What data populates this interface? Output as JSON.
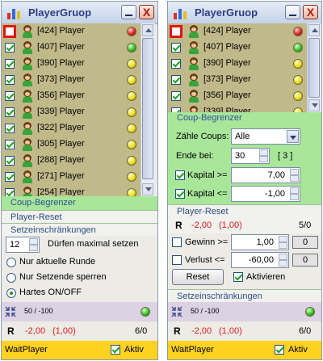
{
  "window_title": "PlayerGruop",
  "close_glyph": "X",
  "players": [
    {
      "label": "[424] Player",
      "checked": false,
      "status": "red"
    },
    {
      "label": "[407] Player",
      "checked": true,
      "status": "green"
    },
    {
      "label": "[390] Player",
      "checked": true,
      "status": "yellow"
    },
    {
      "label": "[373] Player",
      "checked": true,
      "status": "yellow"
    },
    {
      "label": "[356] Player",
      "checked": true,
      "status": "yellow"
    },
    {
      "label": "[339] Player",
      "checked": true,
      "status": "yellow"
    },
    {
      "label": "[322] Player",
      "checked": true,
      "status": "yellow"
    },
    {
      "label": "[305] Player",
      "checked": true,
      "status": "yellow"
    },
    {
      "label": "[288] Player",
      "checked": true,
      "status": "yellow"
    },
    {
      "label": "[271] Player",
      "checked": true,
      "status": "yellow"
    },
    {
      "label": "[254] Player",
      "checked": true,
      "status": "yellow"
    }
  ],
  "sections": {
    "coup_begrenzer": "Coup-Begrenzer",
    "player_reset": "Player-Reset",
    "setzeinschraenkungen": "Setzeinschränkungen"
  },
  "left": {
    "dueerfen_value": "12",
    "dueerfen_label": "Dürfen maximal setzen",
    "radios": [
      {
        "label": "Nur aktuelle Runde",
        "selected": false
      },
      {
        "label": "Nur Setzende sperren",
        "selected": false
      },
      {
        "label": "Hartes ON/OFF",
        "selected": true
      }
    ],
    "ratio": "50 / -100",
    "r_label": "R",
    "r_values": "-2,00",
    "r_paren": "(1,00)",
    "r_count": "6/0",
    "footer_name": "WaitPlayer",
    "aktiv_label": "Aktiv",
    "aktiv_checked": true
  },
  "right": {
    "zaehle_label": "Zähle Coups:",
    "zaehle_value": "Alle",
    "ende_label": "Ende bei:",
    "ende_value": "30",
    "ende_count": "[ 3 ]",
    "kapital_ge_label": "Kapital >=",
    "kapital_ge_value": "7,00",
    "kapital_ge_checked": true,
    "kapital_le_label": "Kapital <=",
    "kapital_le_value": "-1,00",
    "kapital_le_checked": true,
    "r_label": "R",
    "r_values": "-2,00",
    "r_paren": "(1,00)",
    "r_count": "5/0",
    "gewinn_label": "Gewinn >=",
    "gewinn_value": "1,00",
    "gewinn_count": "0",
    "verlust_label": "Verlust <=",
    "verlust_value": "-60,00",
    "verlust_count": "0",
    "reset_label": "Reset",
    "aktivieren_label": "Aktivieren",
    "aktivieren_checked": true,
    "ratio": "50 / -100",
    "r2_label": "R",
    "r2_values": "-2,00",
    "r2_paren": "(1,00)",
    "r2_count": "6/0",
    "footer_name": "WaitPlayer",
    "aktiv_label": "Aktiv",
    "aktiv_checked": true
  }
}
